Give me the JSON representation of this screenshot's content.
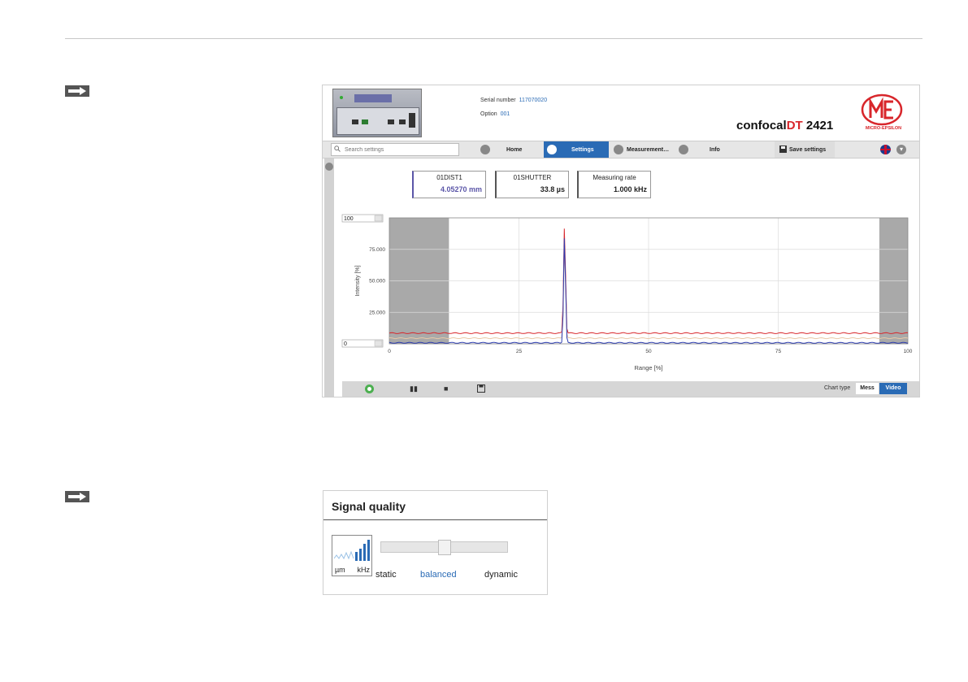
{
  "header": {
    "serial_label": "Serial number",
    "serial_value": "117070020",
    "option_label": "Option",
    "option_value": "001",
    "product_prefix": "confocal",
    "product_dt": "DT",
    "product_model": "2421",
    "brand_text": "MICRO-EPSILON",
    "brand_color": "#d8262b"
  },
  "nav": {
    "search_placeholder": "Search settings",
    "home": "Home",
    "settings": "Settings",
    "measurement": "Measurement…",
    "info": "Info",
    "save": "Save settings",
    "active_color": "#2a6bb5"
  },
  "measurements": [
    {
      "name": "01DIST1",
      "value": "4.05270 mm"
    },
    {
      "name": "01SHUTTER",
      "value": "33.8 µs"
    },
    {
      "name": "Measuring rate",
      "value": "1.000 kHz"
    }
  ],
  "chart_data": {
    "type": "line",
    "xlabel": "Range [%]",
    "ylabel": "Intensity [%]",
    "xlim": [
      0,
      100
    ],
    "ylim": [
      0,
      100
    ],
    "x_ticks": [
      "0",
      "25",
      "50",
      "75",
      "100"
    ],
    "y_ticks": [
      "25.000",
      "50.000",
      "75.000"
    ],
    "y_max_input": "100",
    "y_min_input": "0",
    "masked_ranges": [
      [
        0,
        11.5
      ],
      [
        94.5,
        100
      ]
    ],
    "series": [
      {
        "color": "#d8262b",
        "baseline": 8.5,
        "peak_x": 33.8,
        "peak_y": 95
      },
      {
        "color": "#e8c9a8",
        "baseline": 4.5,
        "peak_x": 33.8,
        "peak_y": 80
      },
      {
        "color": "#2b3bb0",
        "baseline": 0.8,
        "peak_x": 33.8,
        "peak_y": 87
      }
    ]
  },
  "toolbar": {
    "chart_type_label": "Chart type",
    "mess": "Mess",
    "video": "Video"
  },
  "signal_quality": {
    "title": "Signal quality",
    "unit_um": "µm",
    "unit_khz": "kHz",
    "static": "static",
    "balanced": "balanced",
    "dynamic": "dynamic",
    "slider_position": 0.5
  }
}
